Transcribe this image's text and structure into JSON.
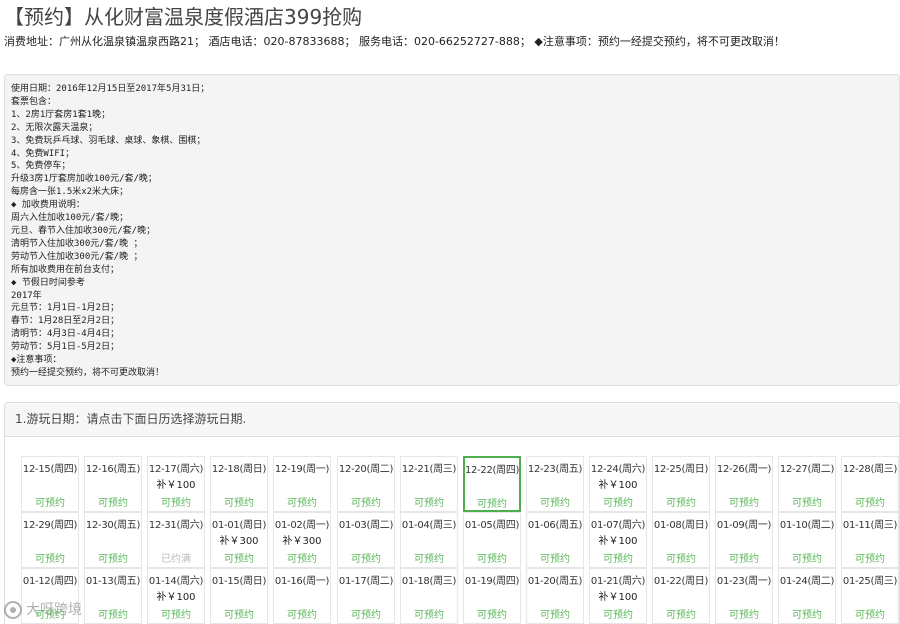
{
  "header": {
    "title": "【预约】从化财富温泉度假酒店399抢购",
    "address": "消费地址：广州从化温泉镇温泉西路21；",
    "hotel_phone": "酒店电话：020-87833688；",
    "service_phone": "服务电话：020-66252727-888；",
    "notice": "◆注意事项：预约一经提交预约，将不可更改取消！"
  },
  "details": {
    "lines": [
      "使用日期：2016年12月15日至2017年5月31日；",
      "套票包含：",
      "1、2房1厅套房1套1晚；",
      "2、无限次露天温泉；",
      "3、免费玩乒乓球、羽毛球、桌球、象棋、围棋；",
      "4、免费WIFI；",
      "5、免费停车；",
      "升级3房1厅套房加收100元/套/晚；",
      "每房含一张1.5米x2米大床；",
      "◆ 加收费用说明：",
      "周六入住加收100元/套/晚；",
      "元旦、春节入住加收300元/套/晚；",
      "清明节入住加收300元/套/晚 ；",
      "劳动节入住加收300元/套/晚 ；",
      "所有加收费用在前台支付；",
      "◆ 节假日时间参考",
      "2017年",
      "元旦节：1月1日-1月2日；",
      "春节：1月28日至2月2日；",
      "清明节：4月3日-4月4日；",
      "劳动节：5月1日-5月2日；",
      "◆注意事项：",
      "预约一经提交预约，将不可更改取消！"
    ]
  },
  "calendar": {
    "step_label": "1.游玩日期：请点击下面日历选择游玩日期.",
    "rows": [
      [
        {
          "date": "12-15(周四)",
          "price": "",
          "status": "可预约"
        },
        {
          "date": "12-16(周五)",
          "price": "",
          "status": "可预约"
        },
        {
          "date": "12-17(周六)",
          "price": "补￥100",
          "status": "可预约"
        },
        {
          "date": "12-18(周日)",
          "price": "",
          "status": "可预约"
        },
        {
          "date": "12-19(周一)",
          "price": "",
          "status": "可预约"
        },
        {
          "date": "12-20(周二)",
          "price": "",
          "status": "可预约"
        },
        {
          "date": "12-21(周三)",
          "price": "",
          "status": "可预约"
        },
        {
          "date": "12-22(周四)",
          "price": "",
          "status": "可预约",
          "selected": true
        },
        {
          "date": "12-23(周五)",
          "price": "",
          "status": "可预约"
        },
        {
          "date": "12-24(周六)",
          "price": "补￥100",
          "status": "可预约"
        },
        {
          "date": "12-25(周日)",
          "price": "",
          "status": "可预约"
        },
        {
          "date": "12-26(周一)",
          "price": "",
          "status": "可预约"
        },
        {
          "date": "12-27(周二)",
          "price": "",
          "status": "可预约"
        },
        {
          "date": "12-28(周三)",
          "price": "",
          "status": "可预约"
        }
      ],
      [
        {
          "date": "12-29(周四)",
          "price": "",
          "status": "可预约"
        },
        {
          "date": "12-30(周五)",
          "price": "",
          "status": "可预约"
        },
        {
          "date": "12-31(周六)",
          "price": "",
          "status": "已约满",
          "full": true
        },
        {
          "date": "01-01(周日)",
          "price": "补￥300",
          "status": "可预约"
        },
        {
          "date": "01-02(周一)",
          "price": "补￥300",
          "status": "可预约"
        },
        {
          "date": "01-03(周二)",
          "price": "",
          "status": "可预约"
        },
        {
          "date": "01-04(周三)",
          "price": "",
          "status": "可预约"
        },
        {
          "date": "01-05(周四)",
          "price": "",
          "status": "可预约"
        },
        {
          "date": "01-06(周五)",
          "price": "",
          "status": "可预约"
        },
        {
          "date": "01-07(周六)",
          "price": "补￥100",
          "status": "可预约"
        },
        {
          "date": "01-08(周日)",
          "price": "",
          "status": "可预约"
        },
        {
          "date": "01-09(周一)",
          "price": "",
          "status": "可预约"
        },
        {
          "date": "01-10(周二)",
          "price": "",
          "status": "可预约"
        },
        {
          "date": "01-11(周三)",
          "price": "",
          "status": "可预约"
        }
      ],
      [
        {
          "date": "01-12(周四)",
          "price": "",
          "status": "可预约"
        },
        {
          "date": "01-13(周五)",
          "price": "",
          "status": "可预约"
        },
        {
          "date": "01-14(周六)",
          "price": "补￥100",
          "status": "可预约"
        },
        {
          "date": "01-15(周日)",
          "price": "",
          "status": "可预约"
        },
        {
          "date": "01-16(周一)",
          "price": "",
          "status": "可预约"
        },
        {
          "date": "01-17(周二)",
          "price": "",
          "status": "可预约"
        },
        {
          "date": "01-18(周三)",
          "price": "",
          "status": "可预约"
        },
        {
          "date": "01-19(周四)",
          "price": "",
          "status": "可预约"
        },
        {
          "date": "01-20(周五)",
          "price": "",
          "status": "可预约"
        },
        {
          "date": "01-21(周六)",
          "price": "补￥100",
          "status": "可预约"
        },
        {
          "date": "01-22(周日)",
          "price": "",
          "status": "可预约"
        },
        {
          "date": "01-23(周一)",
          "price": "",
          "status": "可预约"
        },
        {
          "date": "01-24(周二)",
          "price": "",
          "status": "可预约"
        },
        {
          "date": "01-25(周三)",
          "price": "",
          "status": "可预约"
        }
      ]
    ]
  },
  "watermark": {
    "text": "大呀跨境"
  },
  "colors": {
    "available": "#5cb85c",
    "selected_border": "#4cae4c",
    "full": "#bbbbbb"
  }
}
